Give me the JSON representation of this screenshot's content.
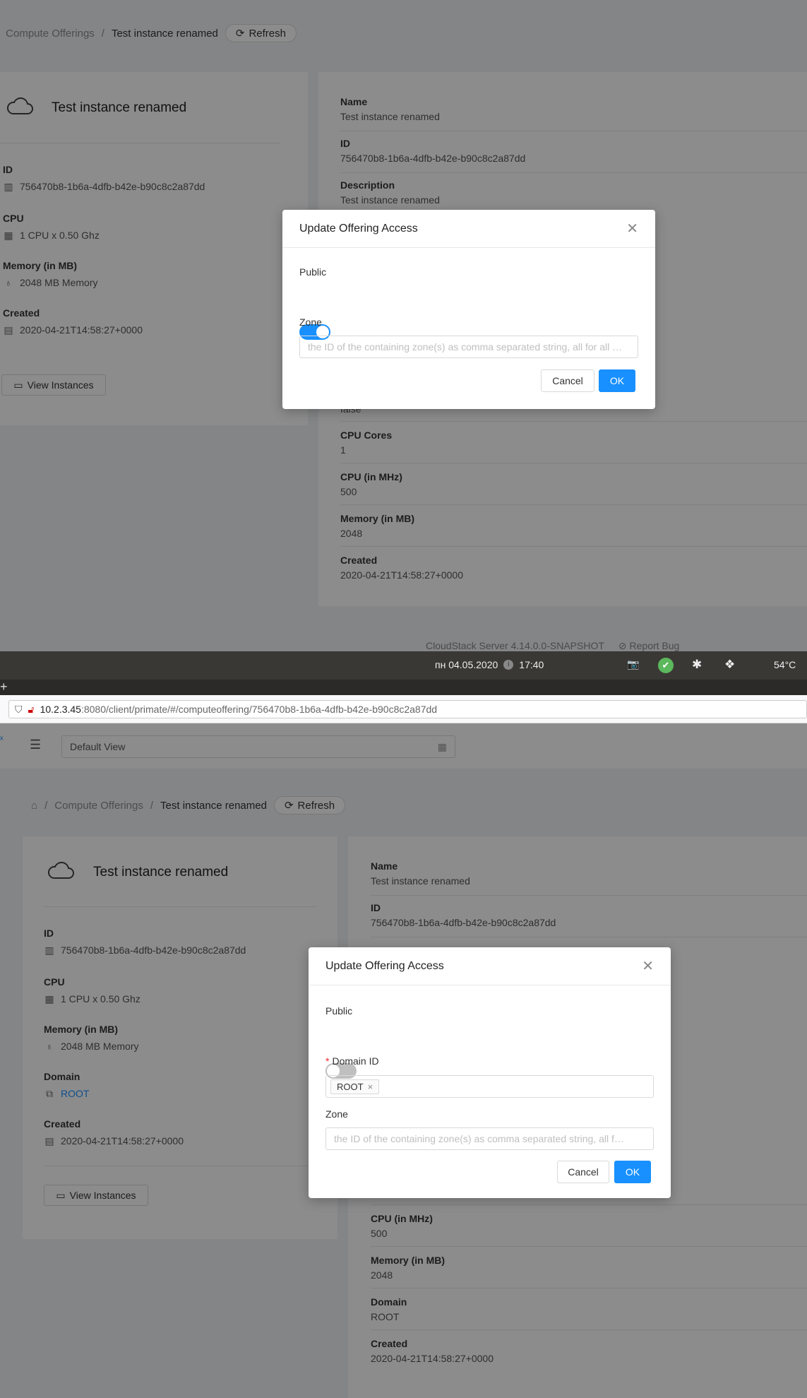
{
  "breadcrumb": {
    "section": "Compute Offerings",
    "current": "Test instance renamed",
    "refresh_label": "Refresh"
  },
  "offering": {
    "name": "Test instance renamed",
    "id_label": "ID",
    "id_value": "756470b8-1b6a-4dfb-b42e-b90c8c2a87dd",
    "cpu_label": "CPU",
    "cpu_value": "1 CPU x 0.50 Ghz",
    "memory_label": "Memory (in MB)",
    "memory_value": "2048 MB Memory",
    "domain_label": "Domain",
    "domain_value": "ROOT",
    "created_label": "Created",
    "created_value": "2020-04-21T14:58:27+0000",
    "view_instances_label": "View Instances"
  },
  "details": {
    "name_label": "Name",
    "name_value": "Test instance renamed",
    "id_label": "ID",
    "id_value": "756470b8-1b6a-4dfb-b42e-b90c8c2a87dd",
    "description_label": "Description",
    "description_value": "Test instance renamed",
    "partial_value": "false",
    "cpu_cores_label": "CPU Cores",
    "cpu_cores_value": "1",
    "cpu_mhz_label": "CPU (in MHz)",
    "cpu_mhz_value": "500",
    "memory_label": "Memory (in MB)",
    "memory_value": "2048",
    "domain_label": "Domain",
    "domain_value": "ROOT",
    "created_label": "Created",
    "created_value": "2020-04-21T14:58:27+0000"
  },
  "modal": {
    "title": "Update Offering Access",
    "public_label": "Public",
    "domain_label": "Domain ID",
    "domain_required_mark": "*",
    "domain_tag": "ROOT",
    "zone_label": "Zone",
    "zone_placeholder_top": "the ID of the containing zone(s) as comma separated string, all for all …",
    "zone_placeholder_bottom": "the ID of the containing zone(s) as comma separated string, all f…",
    "cancel_label": "Cancel",
    "ok_label": "OK"
  },
  "modal_top": {
    "public_on": true
  },
  "modal_bottom": {
    "public_on": false
  },
  "footer": {
    "server_version": "CloudStack Server 4.14.0.0-SNAPSHOT",
    "report_bug": "Report Bug"
  },
  "taskbar": {
    "datetime": "пн 04.05.2020",
    "time": "17:40",
    "temperature": "54°C"
  },
  "browser": {
    "url_host": "10.2.3.45",
    "url_path": ":8080/client/primate/#/computeoffering/756470b8-1b6a-4dfb-b42e-b90c8c2a87dd",
    "new_tab": "+"
  },
  "header": {
    "view_select": "Default View"
  },
  "colors": {
    "primary": "#1890ff",
    "required": "#f5222d"
  }
}
